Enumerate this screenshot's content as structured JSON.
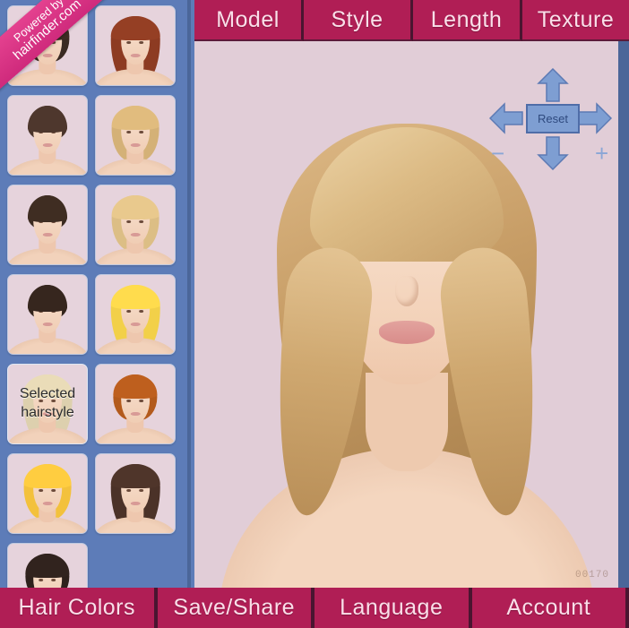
{
  "app": {
    "ribbon_line1": "Powered by",
    "ribbon_line2": "hairfinder.com",
    "watermark": "00170"
  },
  "top_tabs": [
    {
      "label": "Model"
    },
    {
      "label": "Style"
    },
    {
      "label": "Length"
    },
    {
      "label": "Texture"
    }
  ],
  "bottom_tabs": [
    {
      "label": "Hair Colors"
    },
    {
      "label": "Save/Share"
    },
    {
      "label": "Language"
    },
    {
      "label": "Account"
    }
  ],
  "navpad": {
    "reset_label": "Reset",
    "up_icon": "arrow-up-icon",
    "down_icon": "arrow-down-icon",
    "left_icon": "arrow-left-icon",
    "right_icon": "arrow-right-icon",
    "zoom_out_label": "−",
    "zoom_in_label": "+"
  },
  "sidebar": {
    "selected_index": 8,
    "selected_label_line1": "Selected",
    "selected_label_line2": "hairstyle",
    "thumbnails": [
      {
        "name": "hairstyle-short-dark-bob",
        "hair": "#3a2a22",
        "shape": "bob",
        "selected": false,
        "label": ""
      },
      {
        "name": "hairstyle-long-auburn-wavy",
        "hair": "#8d3b22",
        "shape": "long",
        "selected": false,
        "label": ""
      },
      {
        "name": "hairstyle-short-brown-fringe",
        "hair": "#4a342a",
        "shape": "pixie",
        "selected": false,
        "label": ""
      },
      {
        "name": "hairstyle-short-blonde-layered",
        "hair": "#d4b177",
        "shape": "med",
        "selected": false,
        "label": ""
      },
      {
        "name": "hairstyle-spiky-dark-brown",
        "hair": "#3b2a20",
        "shape": "pixie",
        "selected": false,
        "label": ""
      },
      {
        "name": "hairstyle-medium-blonde-curly",
        "hair": "#dcbe85",
        "shape": "med",
        "selected": false,
        "label": ""
      },
      {
        "name": "hairstyle-pixie-dark-brown",
        "hair": "#33241c",
        "shape": "pixie",
        "selected": false,
        "label": ""
      },
      {
        "name": "hairstyle-long-bright-blonde",
        "hair": "#f2d049",
        "shape": "long",
        "selected": false,
        "label": ""
      },
      {
        "name": "hairstyle-long-blonde-wavy",
        "hair": "#ddd0ae",
        "shape": "long",
        "selected": true,
        "label": "Selected hairstyle"
      },
      {
        "name": "hairstyle-short-copper-bob",
        "hair": "#b35a1c",
        "shape": "bob",
        "selected": false,
        "label": ""
      },
      {
        "name": "hairstyle-curly-golden-blonde",
        "hair": "#f3c13c",
        "shape": "med",
        "selected": false,
        "label": ""
      },
      {
        "name": "hairstyle-long-dark-brown-wavy",
        "hair": "#4b3228",
        "shape": "long",
        "selected": false,
        "label": ""
      },
      {
        "name": "hairstyle-asymmetric-dark-bob",
        "hair": "#2e211c",
        "shape": "bob",
        "selected": false,
        "label": ""
      }
    ]
  },
  "viewer": {
    "model_name": "model-portrait",
    "hair_color": "#cfa870",
    "background": "#e1cdd7"
  },
  "colors": {
    "tab_magenta": "#b01e55",
    "tab_divider": "#4a1530",
    "sidebar_blue": "#5d7cb8",
    "sidebar_border": "#4b6699",
    "canvas_pink": "#e1cdd7",
    "control_blue": "#7e9ed2",
    "ribbon_pink": "#d9337f"
  }
}
